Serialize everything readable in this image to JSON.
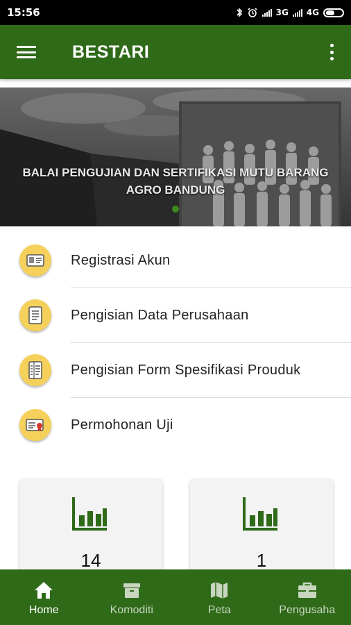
{
  "status_bar": {
    "time": "15:56",
    "network_1": "3G",
    "network_2": "4G",
    "icons": [
      "bluetooth-icon",
      "alarm-icon",
      "signal-icon",
      "signal-icon",
      "battery-icon"
    ]
  },
  "app_bar": {
    "title": "BESTARI",
    "menu_icon": "hamburger-menu-icon",
    "more_icon": "more-vert-icon"
  },
  "banner": {
    "caption_line1": "BALAI PENGUJIAN DAN SERTIFIKASI MUTU BARANG",
    "caption_line2": "AGRO BANDUNG"
  },
  "menu": {
    "items": [
      {
        "label": "Registrasi Akun",
        "icon": "id-card-icon"
      },
      {
        "label": "Pengisian Data Perusahaan",
        "icon": "document-list-icon"
      },
      {
        "label": "Pengisian Form Spesifikasi Prouduk",
        "icon": "form-icon"
      },
      {
        "label": "Permohonan Uji",
        "icon": "certificate-icon"
      }
    ]
  },
  "stats": [
    {
      "value": "14",
      "icon": "bar-chart-icon"
    },
    {
      "value": "1",
      "icon": "bar-chart-icon"
    }
  ],
  "bottom_nav": {
    "items": [
      {
        "label": "Home",
        "icon": "home-icon",
        "active": true
      },
      {
        "label": "Komoditi",
        "icon": "box-icon",
        "active": false
      },
      {
        "label": "Peta",
        "icon": "map-icon",
        "active": false
      },
      {
        "label": "Pengusaha",
        "icon": "briefcase-icon",
        "active": false
      }
    ]
  },
  "colors": {
    "primary": "#2f6a19",
    "accent": "#3c8a1e",
    "icon_badge": "#f5d15c"
  }
}
